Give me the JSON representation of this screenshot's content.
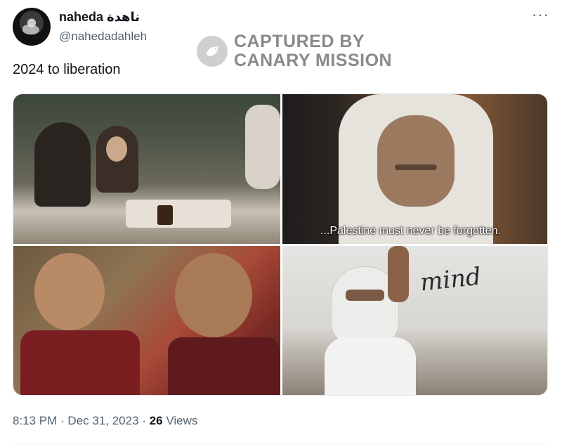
{
  "tweet": {
    "author": {
      "display_name": "naheda ناهدة",
      "handle": "@nahedadahleh"
    },
    "text": "2024 to liberation",
    "more_label": "···",
    "timestamp": {
      "time": "8:13 PM",
      "separator1": " · ",
      "date": "Dec 31, 2023",
      "separator2": " · ",
      "views_count": "26",
      "views_label": " Views"
    }
  },
  "watermark": {
    "line1": "CAPTURED BY",
    "line2": "CANARY MISSION"
  },
  "media": {
    "photos": [
      {
        "caption": ""
      },
      {
        "caption": "...Palestine must never be forgotten."
      },
      {
        "caption": ""
      },
      {
        "caption": "",
        "graffiti": "mind"
      }
    ]
  },
  "icons": {
    "more": "ellipsis-icon",
    "watermark": "canary-bird-icon"
  }
}
